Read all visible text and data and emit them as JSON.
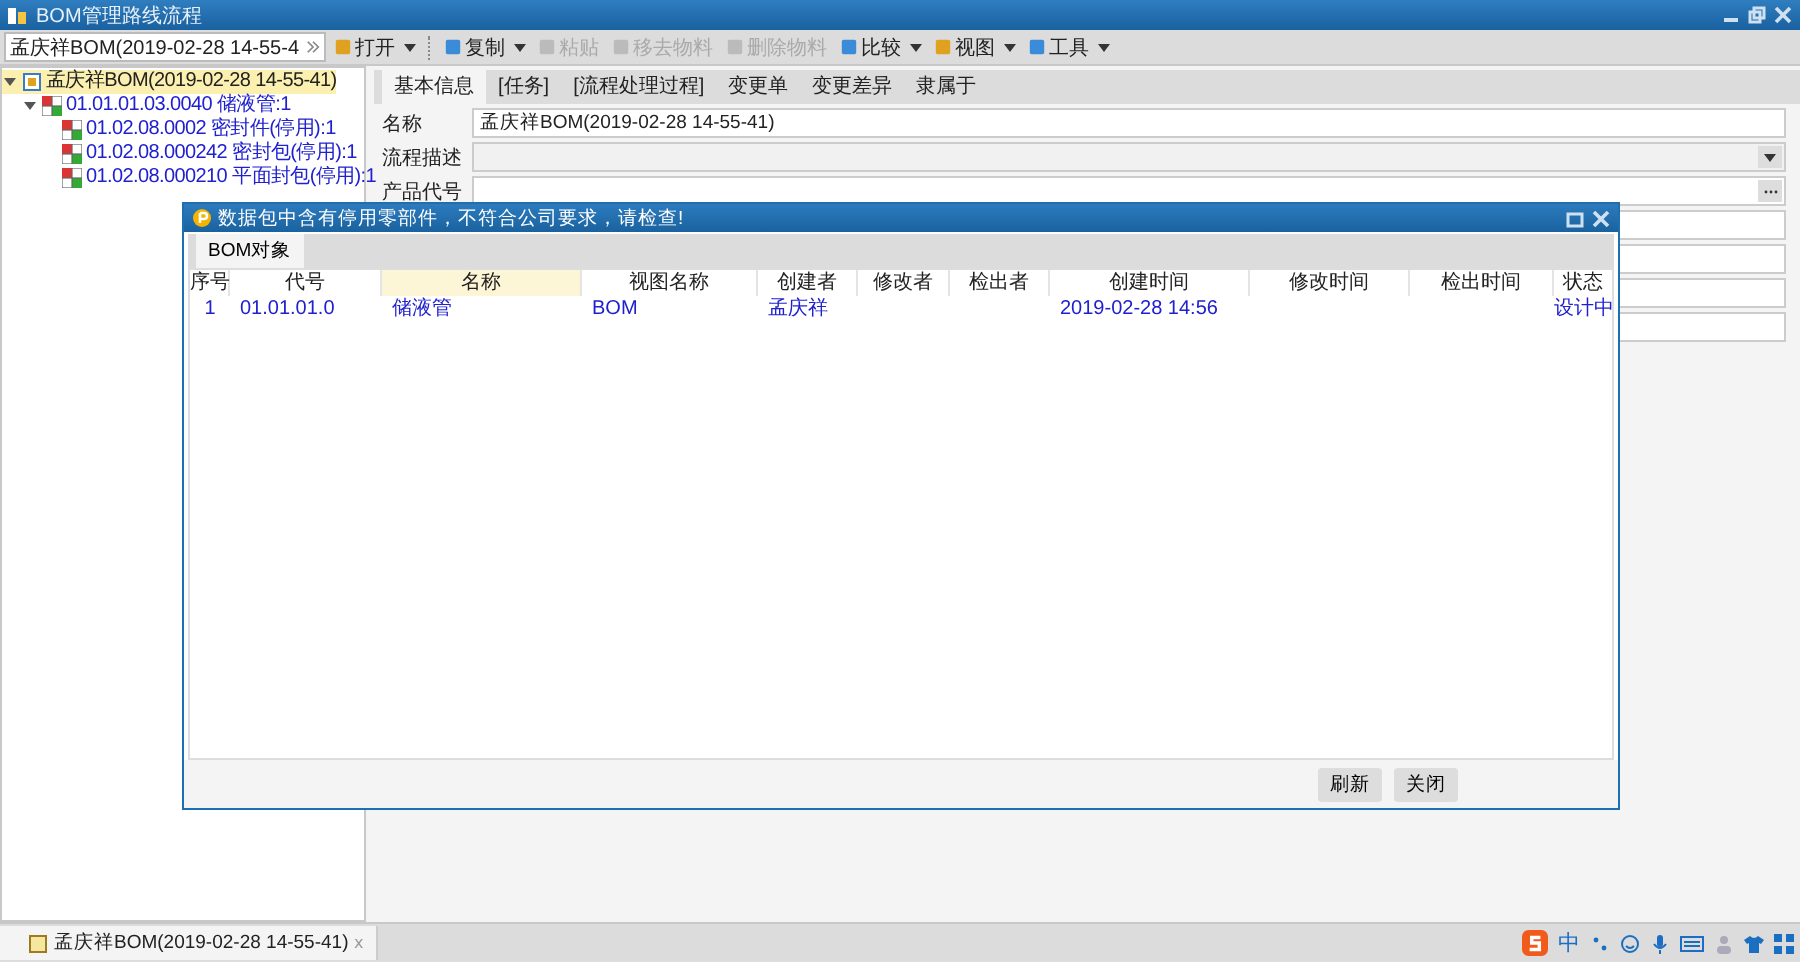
{
  "window": {
    "title": "BOM管理路线流程"
  },
  "toolbar": {
    "combo": "孟庆祥BOM(2019-02-28  14-55-4",
    "items": [
      {
        "label": "打开",
        "kind": "menu",
        "disabled": false,
        "separator_before": false
      },
      {
        "label": "复制",
        "kind": "menu",
        "disabled": false,
        "separator_before": true
      },
      {
        "label": "粘贴",
        "kind": "button",
        "disabled": true,
        "separator_before": false
      },
      {
        "label": "移去物料",
        "kind": "button",
        "disabled": true,
        "separator_before": false
      },
      {
        "label": "删除物料",
        "kind": "button",
        "disabled": true,
        "separator_before": false
      },
      {
        "label": "比较",
        "kind": "menu",
        "disabled": false,
        "separator_before": false
      },
      {
        "label": "视图",
        "kind": "menu",
        "disabled": false,
        "separator_before": false
      },
      {
        "label": "工具",
        "kind": "menu",
        "disabled": false,
        "separator_before": false
      }
    ]
  },
  "tree": [
    {
      "label": "孟庆祥BOM(2019-02-28  14-55-41)",
      "selected": true,
      "expanded": true,
      "children": [
        {
          "label": "01.01.01.03.0040 储液管:1",
          "selected": false,
          "expanded": true,
          "children": [
            {
              "label": "01.02.08.0002 密封件(停用):1",
              "selected": false,
              "expanded": false
            },
            {
              "label": "01.02.08.000242 密封包(停用):1",
              "selected": false,
              "expanded": false
            },
            {
              "label": "01.02.08.000210 平面封包(停用):1",
              "selected": false,
              "expanded": false
            }
          ]
        }
      ]
    }
  ],
  "tabs": [
    {
      "label": "基本信息",
      "selected": true
    },
    {
      "label": "[任务]",
      "selected": false
    },
    {
      "label": "[流程处理过程]",
      "selected": false
    },
    {
      "label": "变更单",
      "selected": false
    },
    {
      "label": "变更差异",
      "selected": false
    },
    {
      "label": "隶属于",
      "selected": false
    }
  ],
  "form": [
    {
      "label": "名称",
      "kind": "text",
      "value": "孟庆祥BOM(2019-02-28  14-55-41)"
    },
    {
      "label": "流程描述",
      "kind": "dropdown"
    },
    {
      "label": "产品代号",
      "kind": "browse"
    },
    {
      "kind": "text"
    },
    {
      "kind": "text"
    },
    {
      "kind": "text"
    },
    {
      "kind": "text"
    }
  ],
  "dialog": {
    "title": "数据包中含有停用零部件，不符合公司要求，请检查!",
    "tab": "BOM对象",
    "columns": [
      {
        "label": "序号",
        "selected": false
      },
      {
        "label": "代号",
        "selected": false
      },
      {
        "label": "名称",
        "selected": true
      },
      {
        "label": "视图名称",
        "selected": false
      },
      {
        "label": "创建者",
        "selected": false
      },
      {
        "label": "修改者",
        "selected": false
      },
      {
        "label": "检出者",
        "selected": false
      },
      {
        "label": "创建时间",
        "selected": false
      },
      {
        "label": "修改时间",
        "selected": false
      },
      {
        "label": "检出时间",
        "selected": false
      },
      {
        "label": "状态",
        "selected": false
      }
    ],
    "rows": [
      {
        "index": "1",
        "code": "01.01.01.0",
        "name": "储液管",
        "view": "BOM",
        "creator": "孟庆祥",
        "created": "2019-02-28 14:56",
        "status": "设计中"
      }
    ],
    "buttons": [
      "刷新",
      "关闭"
    ]
  },
  "bottom_tab": {
    "label": "孟庆祥BOM(2019-02-28  14-55-41)",
    "close": "ⅹ"
  },
  "ime": {
    "mode": "中"
  }
}
